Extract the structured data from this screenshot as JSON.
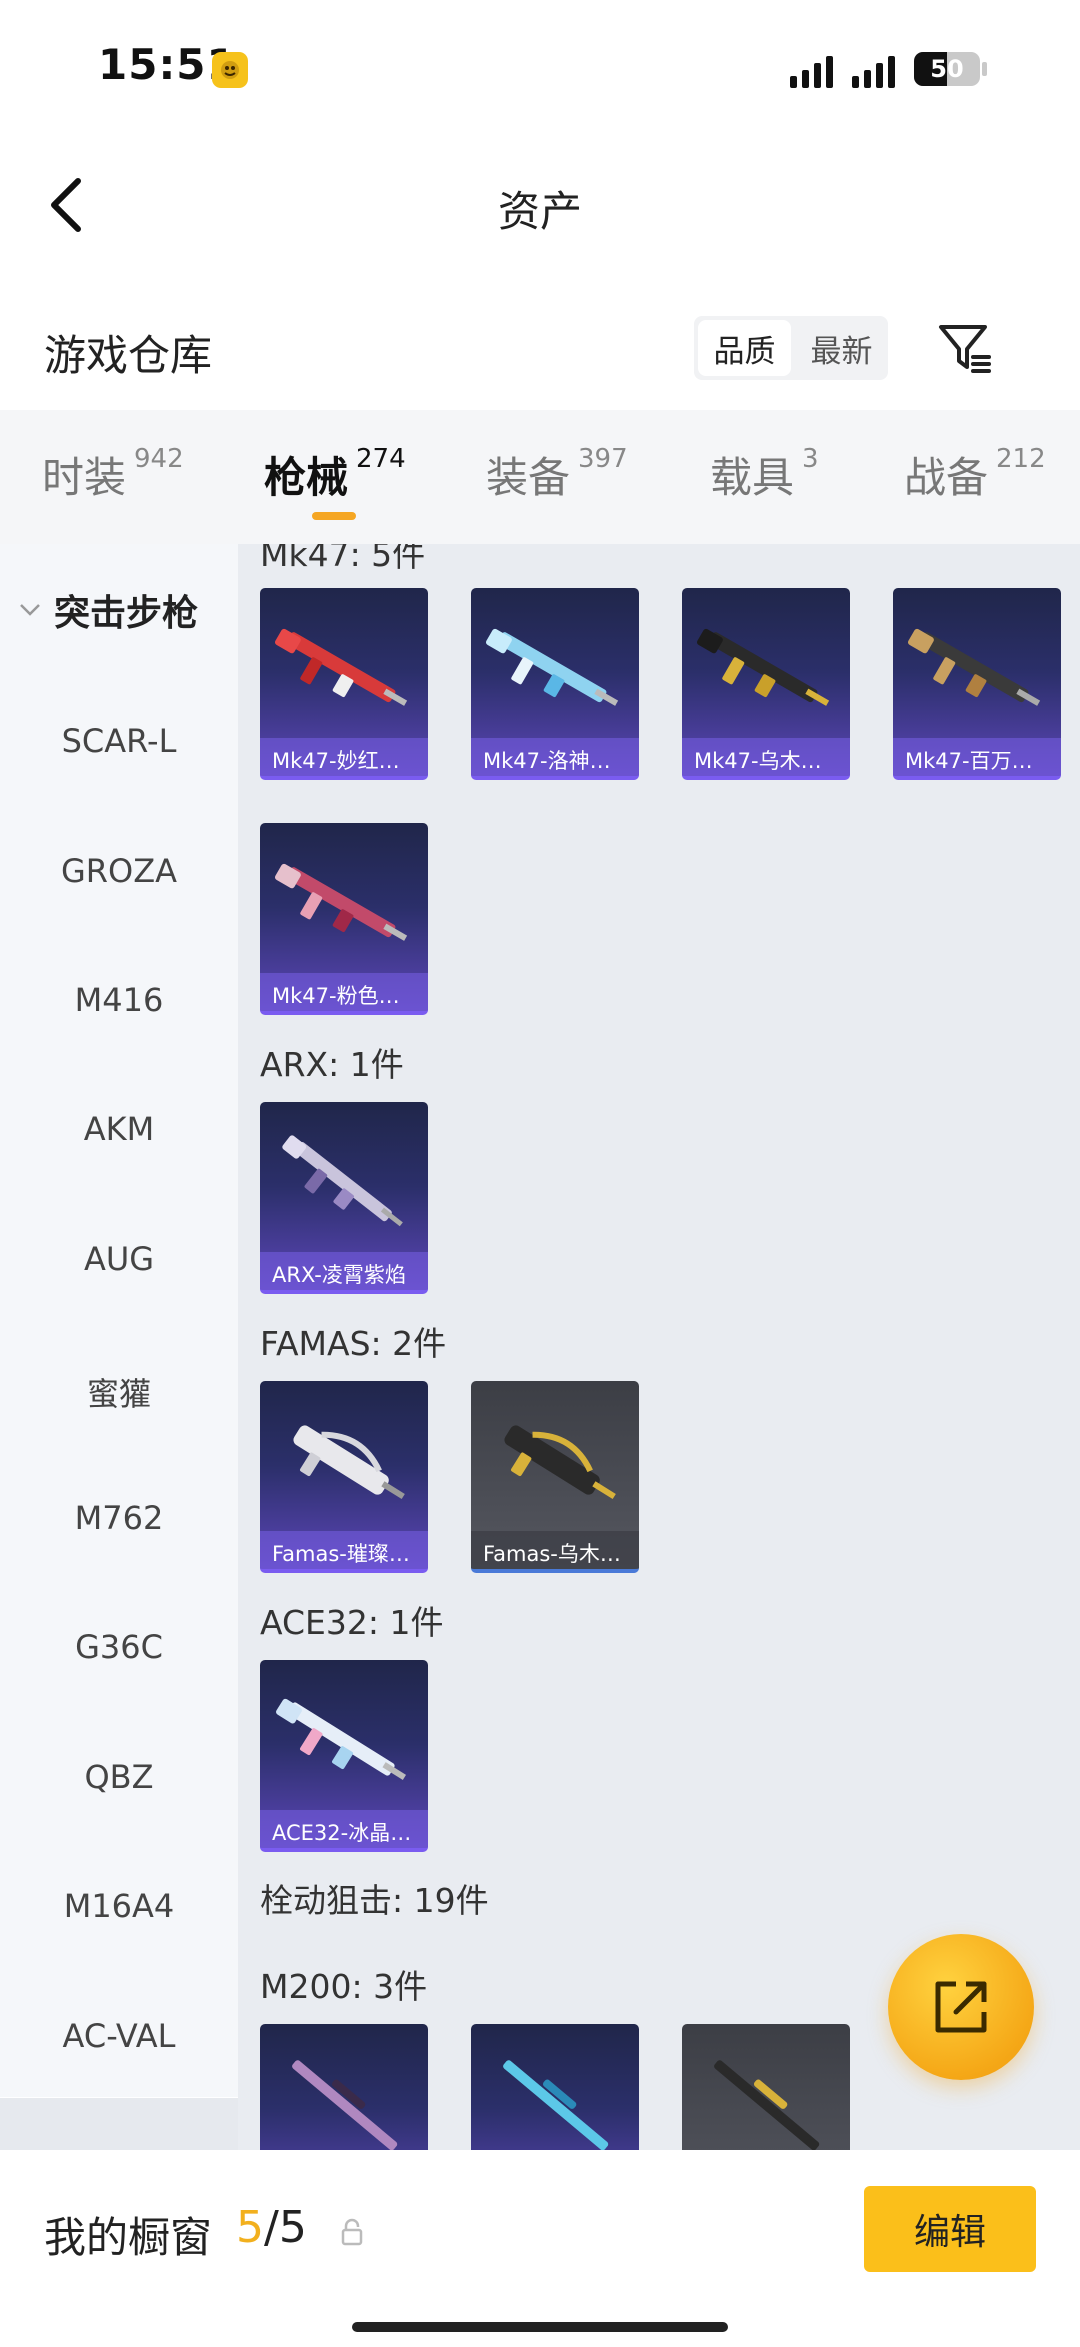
{
  "status_bar": {
    "time": "15:51",
    "battery_level": "50"
  },
  "nav": {
    "title": "资产"
  },
  "section": {
    "title": "游戏仓库",
    "sort_options": [
      "品质",
      "最新"
    ],
    "sort_selected": "品质"
  },
  "tabs": [
    {
      "label": "时装",
      "count": "942"
    },
    {
      "label": "枪械",
      "count": "274",
      "active": true
    },
    {
      "label": "装备",
      "count": "397"
    },
    {
      "label": "载具",
      "count": "3"
    },
    {
      "label": "战备",
      "count": "212"
    }
  ],
  "sidebar": {
    "category": "突击步枪",
    "items": [
      "SCAR-L",
      "GROZA",
      "M416",
      "AKM",
      "AUG",
      "蜜獾",
      "M762",
      "G36C",
      "QBZ",
      "M16A4",
      "AC-VAL"
    ]
  },
  "groups": {
    "mk47": {
      "label": "Mk47: 5件",
      "items": [
        "Mk47-妙红…",
        "Mk47-洛神…",
        "Mk47-乌木…",
        "Mk47-百万…",
        "Mk47-粉色…"
      ]
    },
    "arx": {
      "label": "ARX: 1件",
      "items": [
        "ARX-凌霄紫焰"
      ]
    },
    "famas": {
      "label": "FAMAS: 2件",
      "items": [
        "Famas-璀璨…",
        "Famas-乌木…"
      ]
    },
    "ace32": {
      "label": "ACE32: 1件",
      "items": [
        "ACE32-冰晶…"
      ]
    },
    "sniper": {
      "label": "栓动狙击: 19件"
    },
    "m200": {
      "label": "M200: 3件"
    }
  },
  "bottom_bar": {
    "label": "我的橱窗",
    "current": "5",
    "separator": "/",
    "max": "5",
    "edit_label": "编辑"
  },
  "colors": {
    "accent": "#f5a623",
    "button_yellow": "#fbbf1a",
    "card_purple": "#2b2f6a",
    "card_gray": "#4b4d55"
  }
}
